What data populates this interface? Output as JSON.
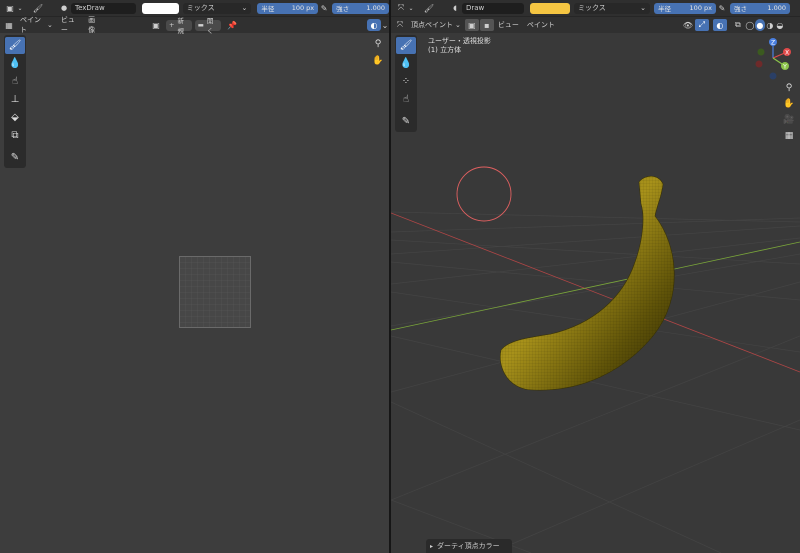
{
  "left": {
    "row1": {
      "brush_name": "TexDraw",
      "color": "#ffffff",
      "blend": "ミックス",
      "radius_label": "半径",
      "radius_value": "100 px",
      "strength_label": "強さ",
      "strength_value": "1.000"
    },
    "row2": {
      "mode": "ペイント",
      "menus": [
        "ビュー",
        "画像"
      ],
      "new_label": "新規",
      "open_label": "開く"
    }
  },
  "right": {
    "row1": {
      "brush_name": "Draw",
      "color": "#f5c542",
      "blend": "ミックス",
      "radius_label": "半径",
      "radius_value": "100 px",
      "strength_label": "強さ",
      "strength_value": "1.000"
    },
    "row2": {
      "mode": "頂点ペイント",
      "menus": [
        "ビュー",
        "ペイント"
      ]
    },
    "viewport": {
      "view_name": "ユーザー・透視投影",
      "object_name": "(1) 立方体"
    },
    "last_operation": "ダーティ頂点カラー",
    "gizmo": {
      "x_label": "X",
      "y_label": "Y",
      "z_label": "Z"
    }
  },
  "colors": {
    "accent": "#4772b3",
    "x_axis": "#e04a4a",
    "y_axis": "#8bc34a",
    "z_axis": "#4a7fe0"
  }
}
